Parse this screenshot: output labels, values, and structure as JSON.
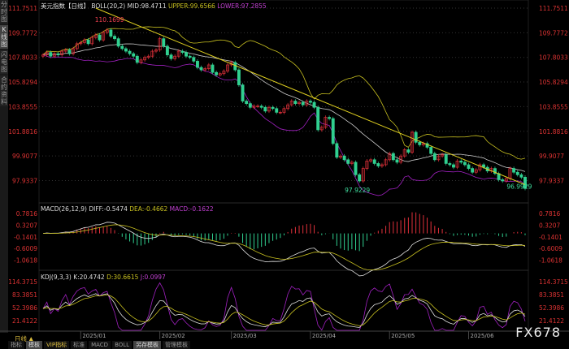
{
  "side_tabs": [
    "分时图",
    "K线图",
    "闪电图",
    "合约资料"
  ],
  "header": {
    "title": "美元指数【日线】",
    "boll": "BOLL(20,2)",
    "mid": "MID:98.4711",
    "upper": "UPPER:99.6566",
    "lower": "LOWER:97.2855"
  },
  "macd_header": {
    "name": "MACD(26,12,9)",
    "diff": "DIFF:-0.5474",
    "dea": "DEA:-0.4662",
    "macd": "MACD:-0.1622"
  },
  "kdj_header": {
    "name": "KDJ(9,3,3)",
    "k": "K:20.4742",
    "d": "D:30.6615",
    "j": "J:0.0997"
  },
  "period_label": "日线 ▲",
  "bottom_tabs": [
    "指标",
    "模板",
    "VIP指标",
    "标准",
    "MACD",
    "BOLL",
    "另存模板",
    "管理模板"
  ],
  "logo": "FX678",
  "colors": {
    "up": "#e0303a",
    "down": "#30d090",
    "mid": "#cccccc",
    "upper": "#c8c020",
    "lower": "#a020c0",
    "trend": "#e0d020"
  },
  "chart_data": {
    "type": "candlestick",
    "price_ticks": [
      "111.7511",
      "109.7772",
      "107.8033",
      "105.8294",
      "103.8555",
      "101.8816",
      "99.9077",
      "97.9337"
    ],
    "macd_ticks": [
      "0.7816",
      "0.3207",
      "-0.1401",
      "-0.6009",
      "-1.0618"
    ],
    "kdj_ticks": [
      "114.3715",
      "83.3851",
      "52.3986",
      "21.4122"
    ],
    "x_ticks": [
      "2025/01",
      "2025/02",
      "2025/03",
      "2025/04",
      "2025/05",
      "2025/06"
    ],
    "x_tick_index": [
      10,
      31,
      50,
      71,
      92,
      113
    ],
    "annotations": [
      {
        "text": "110.1699",
        "index": 17
      },
      {
        "text": "97.9229",
        "index": 84
      },
      {
        "text": "96.9929",
        "index": 127
      }
    ],
    "closes": [
      108.0,
      108.2,
      107.9,
      108.1,
      108.0,
      108.3,
      108.4,
      108.1,
      108.5,
      108.9,
      109.0,
      109.2,
      108.9,
      109.4,
      109.6,
      109.2,
      109.8,
      110.0,
      109.5,
      109.3,
      108.7,
      108.5,
      108.3,
      108.1,
      107.9,
      107.4,
      107.6,
      107.8,
      107.9,
      108.3,
      108.4,
      109.3,
      108.7,
      108.0,
      107.7,
      107.9,
      108.3,
      108.2,
      107.9,
      107.8,
      107.5,
      107.0,
      106.8,
      106.9,
      107.2,
      106.6,
      106.4,
      106.5,
      106.7,
      107.2,
      107.4,
      106.8,
      105.6,
      104.3,
      104.1,
      103.8,
      103.9,
      103.9,
      103.8,
      103.5,
      103.8,
      103.7,
      103.4,
      103.4,
      103.7,
      104.0,
      104.3,
      104.1,
      104.2,
      104.0,
      104.3,
      104.2,
      103.8,
      102.0,
      102.2,
      103.0,
      102.9,
      100.9,
      99.8,
      99.9,
      99.6,
      99.3,
      99.4,
      98.4,
      97.9,
      98.9,
      99.5,
      99.6,
      99.3,
      99.1,
      99.2,
      99.6,
      100.1,
      99.6,
      99.4,
      99.9,
      100.4,
      100.2,
      101.8,
      101.0,
      100.8,
      100.9,
      100.6,
      100.1,
      99.6,
      99.9,
      100.0,
      99.3,
      99.2,
      99.0,
      99.5,
      99.4,
      99.2,
      98.9,
      98.6,
      98.8,
      99.2,
      99.0,
      98.7,
      98.9,
      98.5,
      98.0,
      97.9,
      98.1,
      98.9,
      98.6,
      98.4,
      98.2,
      97.3
    ],
    "trendline": [
      {
        "index": 14,
        "price": 111.75
      },
      {
        "index": 128,
        "price": 97.6
      }
    ]
  }
}
